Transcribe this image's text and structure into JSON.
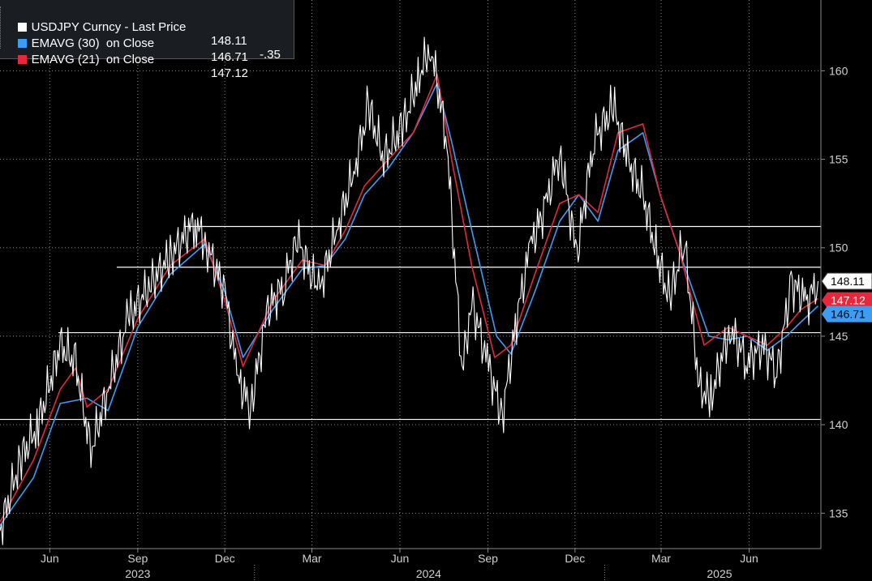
{
  "legend": {
    "rows": [
      {
        "label": "USDJPY Curncy - Last Price",
        "value": "148.11",
        "change": "-.35",
        "color": "#ffffff"
      },
      {
        "label": "EMAVG (30)  on Close",
        "value": "146.71",
        "change": "",
        "color": "#3d9df2"
      },
      {
        "label": "EMAVG (21)  on Close",
        "value": "147.12",
        "change": "",
        "color": "#e8273a"
      }
    ]
  },
  "price_tags": {
    "last": "148.11",
    "ema21": "147.12",
    "ema30": "146.71"
  },
  "colors": {
    "background": "#000000",
    "price": "#ffffff",
    "ema30": "#3d9df2",
    "ema21": "#e8273a",
    "grid": "#ffffff"
  },
  "chart_data": {
    "type": "line",
    "ylim": [
      133,
      164
    ],
    "xlim": [
      "2023-04-10",
      "2025-08-15"
    ],
    "grid": true,
    "yticks": [
      135,
      140,
      145,
      150,
      155,
      160
    ],
    "xticks": [
      {
        "date": "2023-06-01",
        "label": "Jun"
      },
      {
        "date": "2023-09-01",
        "label": "Sep"
      },
      {
        "date": "2023-12-01",
        "label": "Dec"
      },
      {
        "date": "2024-03-01",
        "label": "Mar"
      },
      {
        "date": "2024-06-01",
        "label": "Jun"
      },
      {
        "date": "2024-09-01",
        "label": "Sep"
      },
      {
        "date": "2024-12-01",
        "label": "Dec"
      },
      {
        "date": "2025-03-01",
        "label": "Mar"
      },
      {
        "date": "2025-06-01",
        "label": "Jun"
      }
    ],
    "years": [
      {
        "date": "2023-09-01",
        "label": "2023"
      },
      {
        "date": "2024-07-01",
        "label": "2024"
      },
      {
        "date": "2025-05-01",
        "label": "2025"
      }
    ],
    "horizontal_lines": [
      {
        "value": 151.2,
        "from": "2023-10-20"
      },
      {
        "value": 148.9,
        "from": "2023-08-10"
      },
      {
        "value": 145.2,
        "from": "2023-06-10"
      },
      {
        "value": 140.3,
        "from": "2023-04-10"
      }
    ],
    "series": [
      {
        "name": "USDJPY Curncy - Last Price",
        "x": [
          "2023-04-10",
          "2023-05-01",
          "2023-05-20",
          "2023-06-12",
          "2023-06-28",
          "2023-07-14",
          "2023-08-01",
          "2023-08-22",
          "2023-09-15",
          "2023-10-05",
          "2023-10-31",
          "2023-11-13",
          "2023-12-01",
          "2023-12-15",
          "2023-12-28",
          "2024-01-15",
          "2024-02-01",
          "2024-02-15",
          "2024-03-08",
          "2024-03-27",
          "2024-04-15",
          "2024-04-29",
          "2024-05-15",
          "2024-06-05",
          "2024-06-20",
          "2024-07-03",
          "2024-07-20",
          "2024-08-05",
          "2024-08-15",
          "2024-09-03",
          "2024-09-16",
          "2024-10-01",
          "2024-10-15",
          "2024-11-01",
          "2024-11-15",
          "2024-12-03",
          "2024-12-20",
          "2025-01-10",
          "2025-01-25",
          "2025-02-10",
          "2025-02-25",
          "2025-03-10",
          "2025-03-25",
          "2025-04-10",
          "2025-04-22",
          "2025-05-12",
          "2025-05-30",
          "2025-06-15",
          "2025-06-30",
          "2025-07-15",
          "2025-08-01",
          "2025-08-12"
        ],
        "values": [
          134.0,
          138.0,
          140.0,
          144.5,
          143.5,
          138.5,
          142.0,
          146.0,
          148.0,
          149.5,
          151.5,
          150.0,
          147.5,
          142.5,
          141.0,
          146.5,
          148.0,
          150.5,
          147.5,
          151.0,
          154.5,
          158.0,
          155.0,
          157.0,
          159.5,
          161.5,
          156.0,
          143.0,
          147.0,
          143.0,
          140.5,
          146.0,
          150.0,
          152.5,
          155.5,
          149.5,
          156.0,
          158.0,
          155.0,
          153.0,
          149.5,
          147.0,
          150.5,
          142.0,
          141.5,
          145.5,
          143.5,
          144.5,
          143.0,
          148.0,
          147.0,
          148.11
        ]
      },
      {
        "name": "EMAVG (30)  on Close",
        "x": [
          "2023-04-10",
          "2023-05-15",
          "2023-06-12",
          "2023-07-10",
          "2023-08-01",
          "2023-09-01",
          "2023-10-05",
          "2023-11-10",
          "2023-12-01",
          "2023-12-20",
          "2024-01-20",
          "2024-02-20",
          "2024-03-15",
          "2024-04-05",
          "2024-04-25",
          "2024-05-20",
          "2024-06-15",
          "2024-07-10",
          "2024-07-25",
          "2024-08-15",
          "2024-09-10",
          "2024-09-25",
          "2024-10-20",
          "2024-11-15",
          "2024-12-05",
          "2024-12-25",
          "2025-01-15",
          "2025-02-10",
          "2025-02-28",
          "2025-03-20",
          "2025-04-20",
          "2025-05-10",
          "2025-05-30",
          "2025-06-20",
          "2025-07-10",
          "2025-07-25",
          "2025-08-12"
        ],
        "values": [
          134.3,
          137.0,
          141.2,
          141.5,
          140.8,
          145.5,
          148.5,
          150.2,
          147.5,
          143.8,
          146.5,
          148.8,
          149.0,
          150.5,
          153.0,
          154.5,
          156.5,
          159.3,
          156.0,
          151.0,
          145.0,
          144.0,
          147.5,
          151.5,
          153.0,
          151.5,
          155.5,
          156.5,
          153.0,
          149.8,
          145.0,
          144.8,
          145.0,
          144.2,
          145.0,
          145.8,
          146.71
        ]
      },
      {
        "name": "EMAVG (21)  on Close",
        "x": [
          "2023-04-10",
          "2023-05-15",
          "2023-06-12",
          "2023-06-28",
          "2023-07-10",
          "2023-08-01",
          "2023-09-01",
          "2023-10-05",
          "2023-11-10",
          "2023-12-01",
          "2023-12-20",
          "2024-01-20",
          "2024-02-20",
          "2024-03-15",
          "2024-04-05",
          "2024-04-25",
          "2024-05-20",
          "2024-06-15",
          "2024-07-10",
          "2024-07-25",
          "2024-08-15",
          "2024-09-08",
          "2024-09-25",
          "2024-10-20",
          "2024-11-15",
          "2024-12-05",
          "2024-12-25",
          "2025-01-15",
          "2025-02-10",
          "2025-02-28",
          "2025-03-20",
          "2025-04-15",
          "2025-05-10",
          "2025-05-30",
          "2025-06-20",
          "2025-07-10",
          "2025-07-25",
          "2025-08-12"
        ],
        "values": [
          134.5,
          138.0,
          142.0,
          143.2,
          141.0,
          142.0,
          146.0,
          149.0,
          150.5,
          147.0,
          143.3,
          147.0,
          149.3,
          149.0,
          151.0,
          153.5,
          155.0,
          156.5,
          159.8,
          155.0,
          149.0,
          143.8,
          144.5,
          148.5,
          152.5,
          153.0,
          152.0,
          156.5,
          157.0,
          153.0,
          149.8,
          144.5,
          145.5,
          145.0,
          144.5,
          145.5,
          146.5,
          147.12
        ]
      }
    ]
  }
}
